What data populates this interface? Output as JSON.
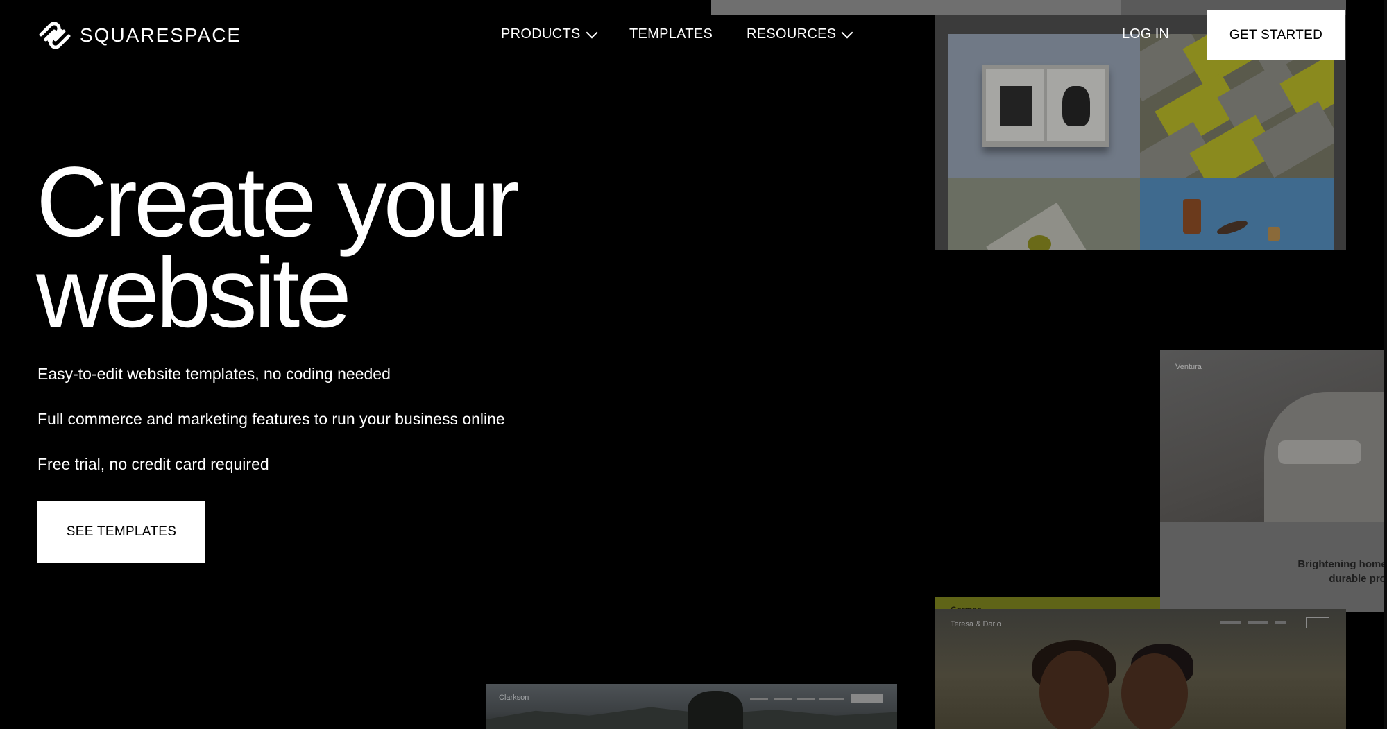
{
  "brand": {
    "name": "SQUARESPACE",
    "icon": "squarespace-logo-icon"
  },
  "nav": {
    "items": [
      {
        "label": "PRODUCTS",
        "has_dropdown": true
      },
      {
        "label": "TEMPLATES",
        "has_dropdown": false
      },
      {
        "label": "RESOURCES",
        "has_dropdown": true
      }
    ],
    "login": "LOG IN",
    "get_started": "GET STARTED"
  },
  "hero": {
    "headline_line1": "Create your",
    "headline_line2": "website",
    "features": [
      "Easy-to-edit website templates, no coding needed",
      "Full commerce and marketing features to run your business online",
      "Free trial, no credit card required"
    ],
    "cta": "SEE TEMPLATES"
  },
  "previews": {
    "ventura": {
      "name": "Ventura",
      "tagline_1": "Brightening homes",
      "tagline_2": "durable prod"
    },
    "cormac": {
      "name": "Cormac"
    },
    "teresa": {
      "name": "Teresa & Dario"
    },
    "clarkson": {
      "name": "Clarkson"
    }
  },
  "colors": {
    "background": "#000000",
    "text": "#ffffff",
    "button_bg": "#ffffff",
    "button_text": "#000000"
  }
}
